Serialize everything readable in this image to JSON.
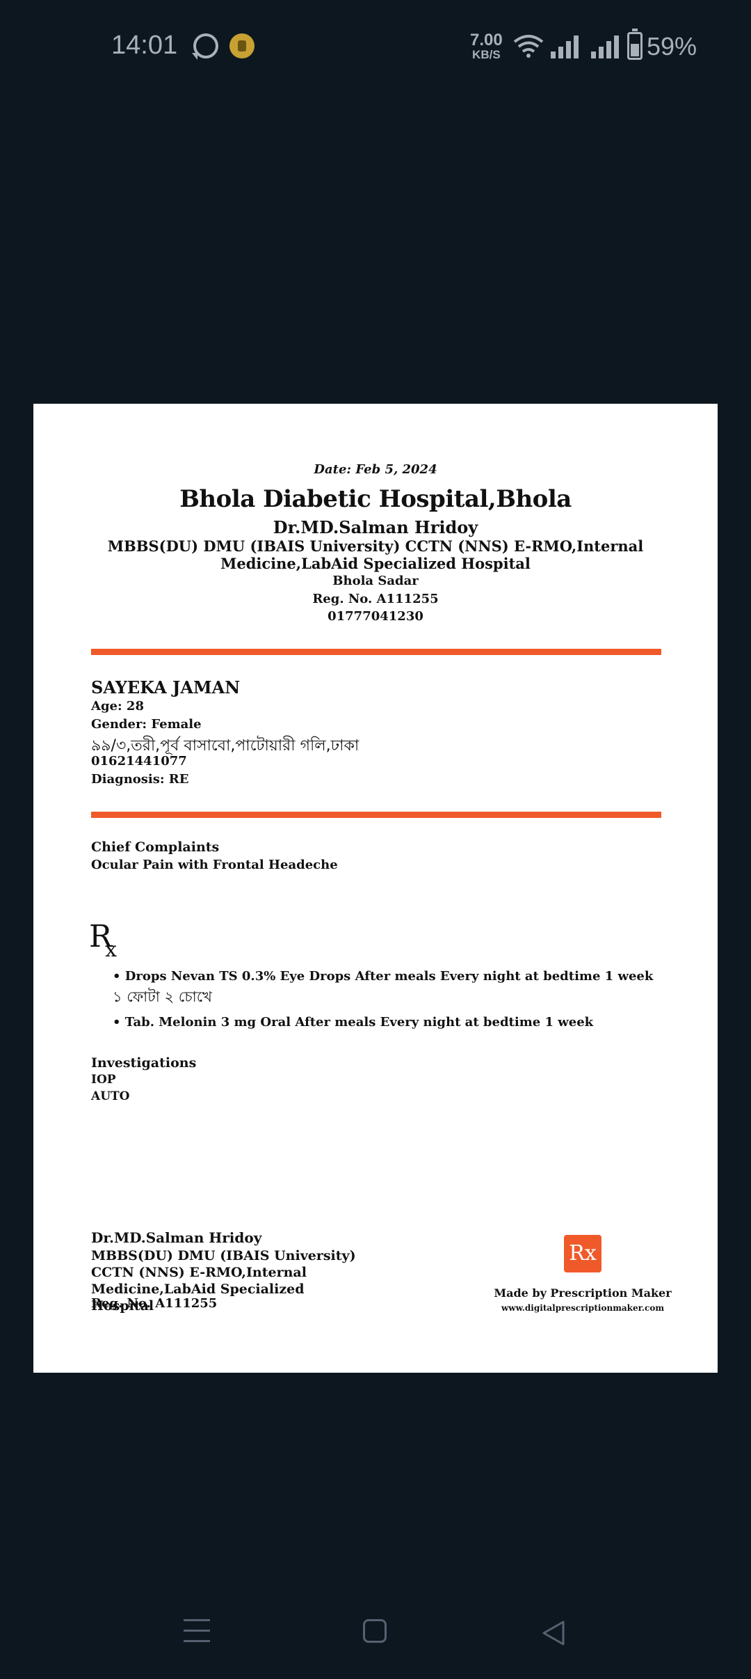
{
  "status_bar": {
    "time": "14:01",
    "net_speed_value": "7.00",
    "net_speed_unit": "KB/S",
    "battery": "59%",
    "icons": [
      "whatsapp-icon",
      "notification-coin-icon",
      "wifi-icon",
      "signal-icon",
      "signal-icon",
      "battery-icon"
    ]
  },
  "prescription": {
    "date": "Date: Feb 5, 2024",
    "hospital": "Bhola Diabetic Hospital,Bhola",
    "doctor_name": "Dr.MD.Salman Hridoy",
    "qualifications": "MBBS(DU) DMU (IBAIS University) CCTN (NNS) E-RMO,Internal Medicine,LabAid Specialized Hospital",
    "address": "Bhola Sadar",
    "reg_no": "Reg. No. A111255",
    "phone": "01777041230",
    "patient": {
      "name": "SAYEKA JAMAN",
      "age": "Age: 28",
      "gender": "Gender: Female",
      "address": "৯৯/৩,তরী,পূর্ব বাসাবো,পাটোয়ারী গলি,ঢাকা",
      "phone": "01621441077",
      "diagnosis": "Diagnosis: RE"
    },
    "chief_complaints_heading": "Chief Complaints",
    "chief_complaints": "Ocular Pain with Frontal Headeche",
    "rx_symbol": "R",
    "rx_symbol_sub": "x",
    "medicines": [
      {
        "line": "• Drops Nevan TS 0.3% Eye Drops After meals Every night at bedtime 1 week",
        "note": "১ ফোটা ২ চোখে"
      },
      {
        "line": "• Tab. Melonin 3 mg Oral After meals Every night at bedtime 1 week",
        "note": ""
      }
    ],
    "investigations_heading": "Investigations",
    "investigations": [
      "IOP",
      "AUTO"
    ],
    "signature": {
      "name": "Dr.MD.Salman Hridoy",
      "qualifications": "MBBS(DU) DMU (IBAIS University) CCTN (NNS) E-RMO,Internal Medicine,LabAid Specialized Hospital",
      "reg_no": "Reg. No. A111255"
    },
    "footer_logo": "Rx",
    "made_by": "Made by Prescription Maker",
    "website": "www.digitalprescriptionmaker.com",
    "accent_color": "#f05a2a"
  },
  "nav_bar": {
    "buttons": [
      "menu-icon",
      "home-icon",
      "back-icon"
    ]
  }
}
